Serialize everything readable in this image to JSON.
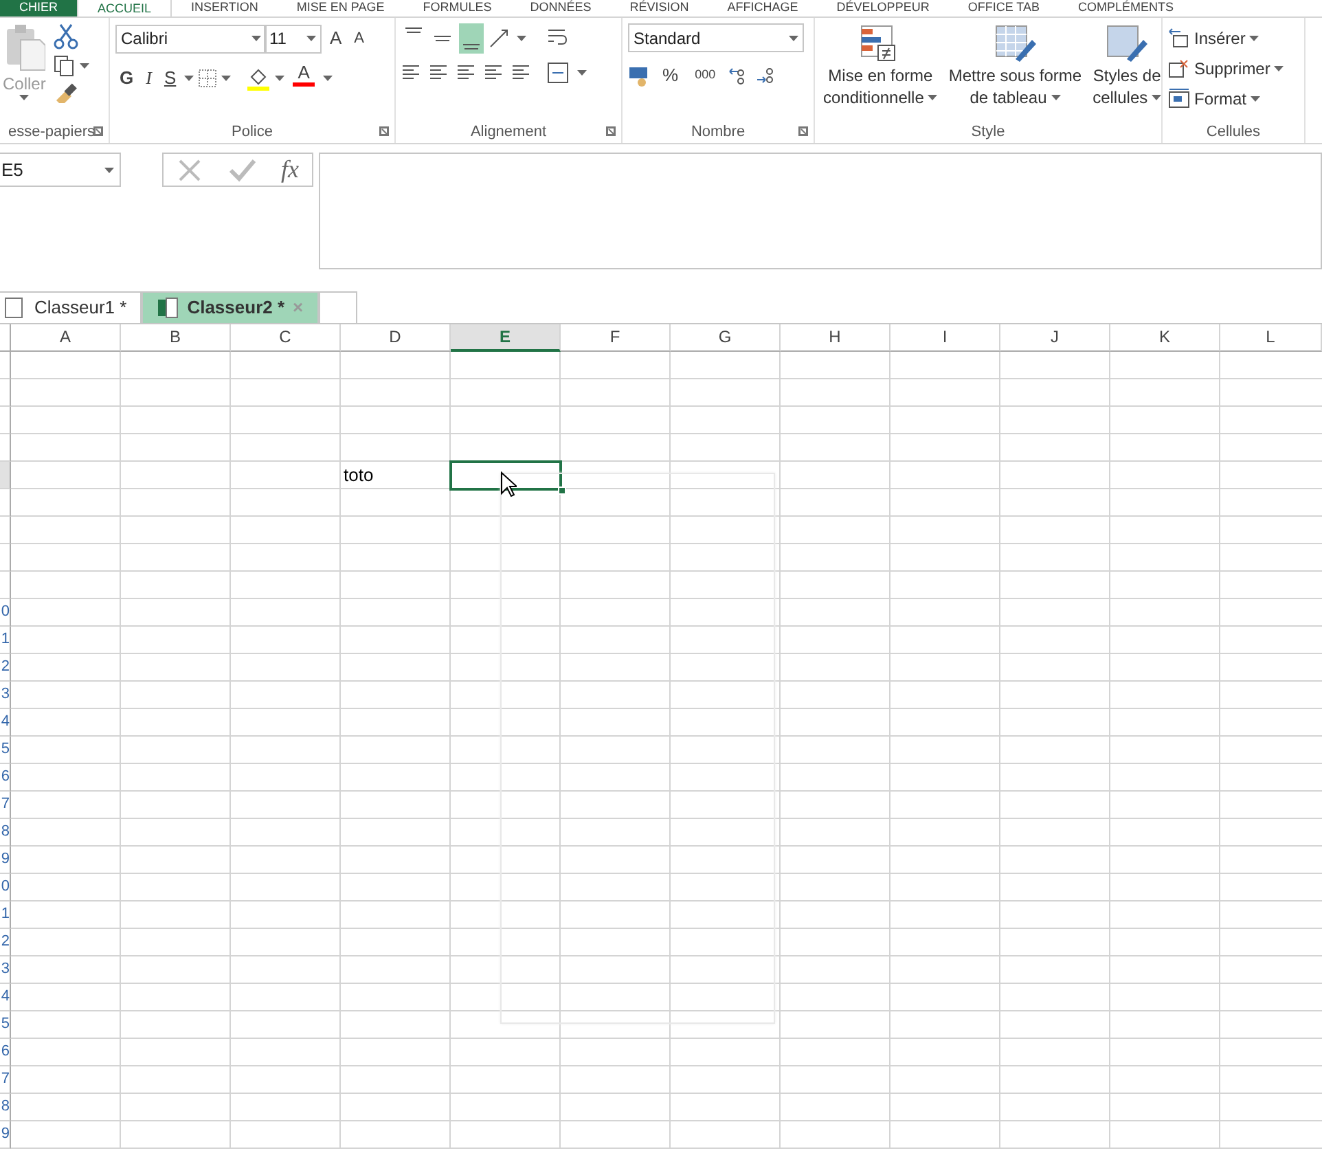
{
  "ribbon_tabs": [
    {
      "label": "CHIER",
      "kind": "file",
      "selected": false
    },
    {
      "label": "ACCUEIL",
      "kind": "tab",
      "selected": true
    },
    {
      "label": "INSERTION",
      "kind": "tab",
      "selected": false
    },
    {
      "label": "MISE EN PAGE",
      "kind": "tab",
      "selected": false
    },
    {
      "label": "FORMULES",
      "kind": "tab",
      "selected": false
    },
    {
      "label": "DONNÉES",
      "kind": "tab",
      "selected": false
    },
    {
      "label": "RÉVISION",
      "kind": "tab",
      "selected": false
    },
    {
      "label": "AFFICHAGE",
      "kind": "tab",
      "selected": false
    },
    {
      "label": "DÉVELOPPEUR",
      "kind": "tab",
      "selected": false
    },
    {
      "label": "OFFICE TAB",
      "kind": "tab",
      "selected": false
    },
    {
      "label": "COMPLÉMENTS",
      "kind": "tab",
      "selected": false
    }
  ],
  "clipboard": {
    "label": "esse-papiers",
    "paste": "Coller",
    "disabled": true
  },
  "font": {
    "label": "Police",
    "font_name": "Calibri",
    "font_size": "11",
    "grow": "A",
    "shrink": "A",
    "bold": "G",
    "italic": "I",
    "underline": "S",
    "font_color_letter": "A"
  },
  "alignment": {
    "label": "Alignement",
    "vertical": [
      {
        "selected": false
      },
      {
        "selected": false
      },
      {
        "selected": true
      }
    ]
  },
  "number": {
    "label": "Nombre",
    "format": "Standard",
    "percent": "%",
    "thousands": "000"
  },
  "style": {
    "label": "Style",
    "buttons": [
      {
        "lines": [
          "Mise en forme",
          "conditionnelle"
        ],
        "kind": "conditional"
      },
      {
        "lines": [
          "Mettre sous forme",
          "de tableau"
        ],
        "kind": "table"
      },
      {
        "lines": [
          "Styles de",
          "cellules"
        ],
        "kind": "cellstyle"
      }
    ]
  },
  "cells_group": {
    "label": "Cellules",
    "buttons": [
      {
        "label": "Insérer",
        "kind": "insert"
      },
      {
        "label": "Supprimer",
        "kind": "delete"
      },
      {
        "label": "Format",
        "kind": "format"
      }
    ]
  },
  "formula_bar": {
    "name_box": "E5",
    "fx": "fx"
  },
  "workbook_tabs": [
    {
      "label": "Classeur1 *",
      "selected": false
    },
    {
      "label": "Classeur2 *",
      "selected": true,
      "close": "×"
    }
  ],
  "columns": [
    {
      "label": "A",
      "selected": false
    },
    {
      "label": "B",
      "selected": false
    },
    {
      "label": "C",
      "selected": false
    },
    {
      "label": "D",
      "selected": false
    },
    {
      "label": "E",
      "selected": true
    },
    {
      "label": "F",
      "selected": false
    },
    {
      "label": "G",
      "selected": false
    },
    {
      "label": "H",
      "selected": false
    },
    {
      "label": "I",
      "selected": false
    },
    {
      "label": "J",
      "selected": false
    },
    {
      "label": "K",
      "selected": false
    },
    {
      "label": "L",
      "selected": false
    }
  ],
  "rows": [
    {
      "selected": false
    },
    {
      "selected": false
    },
    {
      "selected": false
    },
    {
      "selected": false
    },
    {
      "selected": true,
      "cells": [
        null,
        null,
        null,
        "toto",
        null
      ]
    },
    {
      "selected": false
    },
    {
      "selected": false
    },
    {
      "selected": false
    },
    {
      "selected": false
    },
    {
      "header": "0",
      "selected": false
    },
    {
      "header": "1",
      "selected": false
    },
    {
      "header": "2",
      "selected": false
    },
    {
      "header": "3",
      "selected": false
    },
    {
      "header": "4",
      "selected": false
    },
    {
      "header": "5",
      "selected": false
    },
    {
      "header": "6",
      "selected": false
    },
    {
      "header": "7",
      "selected": false
    },
    {
      "header": "8",
      "selected": false
    },
    {
      "header": "9",
      "selected": false
    },
    {
      "header": "0",
      "selected": false
    },
    {
      "header": "1",
      "selected": false
    },
    {
      "header": "2",
      "selected": false
    },
    {
      "header": "3",
      "selected": false
    },
    {
      "header": "4",
      "selected": false
    },
    {
      "header": "5",
      "selected": false
    },
    {
      "header": "6",
      "selected": false
    },
    {
      "header": "7",
      "selected": false
    },
    {
      "header": "8",
      "selected": false
    },
    {
      "header": "9",
      "selected": false
    }
  ]
}
